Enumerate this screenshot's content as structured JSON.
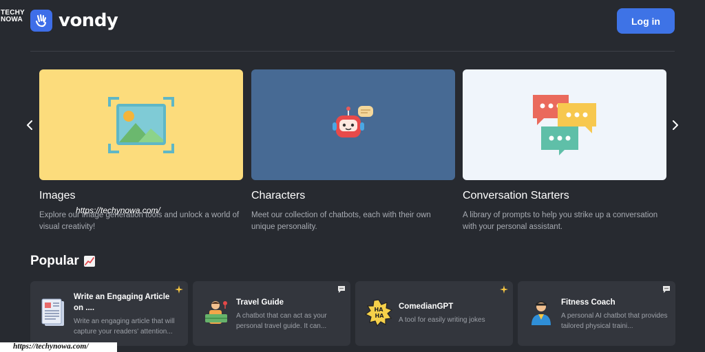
{
  "watermark": {
    "line1": "TECHY",
    "line2": "NOWA",
    "url_mid": "https://techynowa.com/",
    "url_bottom": "https://techynowa.com/"
  },
  "header": {
    "brand": "vondy",
    "login_label": "Log in",
    "accent": "#3e73e6"
  },
  "carousel": {
    "prev_icon": "chevron-left-icon",
    "next_icon": "chevron-right-icon",
    "cards": [
      {
        "title": "Images",
        "description": "Explore our image generation tools and unlock a world of visual creativity!",
        "bg": "#fcdc7c",
        "icon": "image-frame-icon"
      },
      {
        "title": "Characters",
        "description": "Meet our collection of chatbots, each with their own unique personality.",
        "bg": "#476a94",
        "icon": "robot-icon"
      },
      {
        "title": "Conversation Starters",
        "description": "A library of prompts to help you strike up a conversation with your personal assistant.",
        "bg": "#f0f5fb",
        "icon": "speech-bubbles-icon"
      }
    ]
  },
  "popular": {
    "heading": "Popular",
    "heading_icon": "chart-increasing-icon",
    "items": [
      {
        "title": "Write an Engaging Article on ....",
        "description": "Write an engaging article that will capture your readers' attention...",
        "icon": "newspaper-icon",
        "badge": "sparkles-icon"
      },
      {
        "title": "Travel Guide",
        "description": "A chatbot that can act as your personal travel guide. It can...",
        "icon": "traveler-icon",
        "badge": "speech-balloon-icon"
      },
      {
        "title": "ComedianGPT",
        "description": "A tool for easily writing jokes",
        "icon": "haha-burst-icon",
        "badge": "sparkles-icon"
      },
      {
        "title": "Fitness Coach",
        "description": "A personal AI chatbot that provides tailored physical traini...",
        "icon": "coach-icon",
        "badge": "speech-balloon-icon"
      }
    ]
  }
}
